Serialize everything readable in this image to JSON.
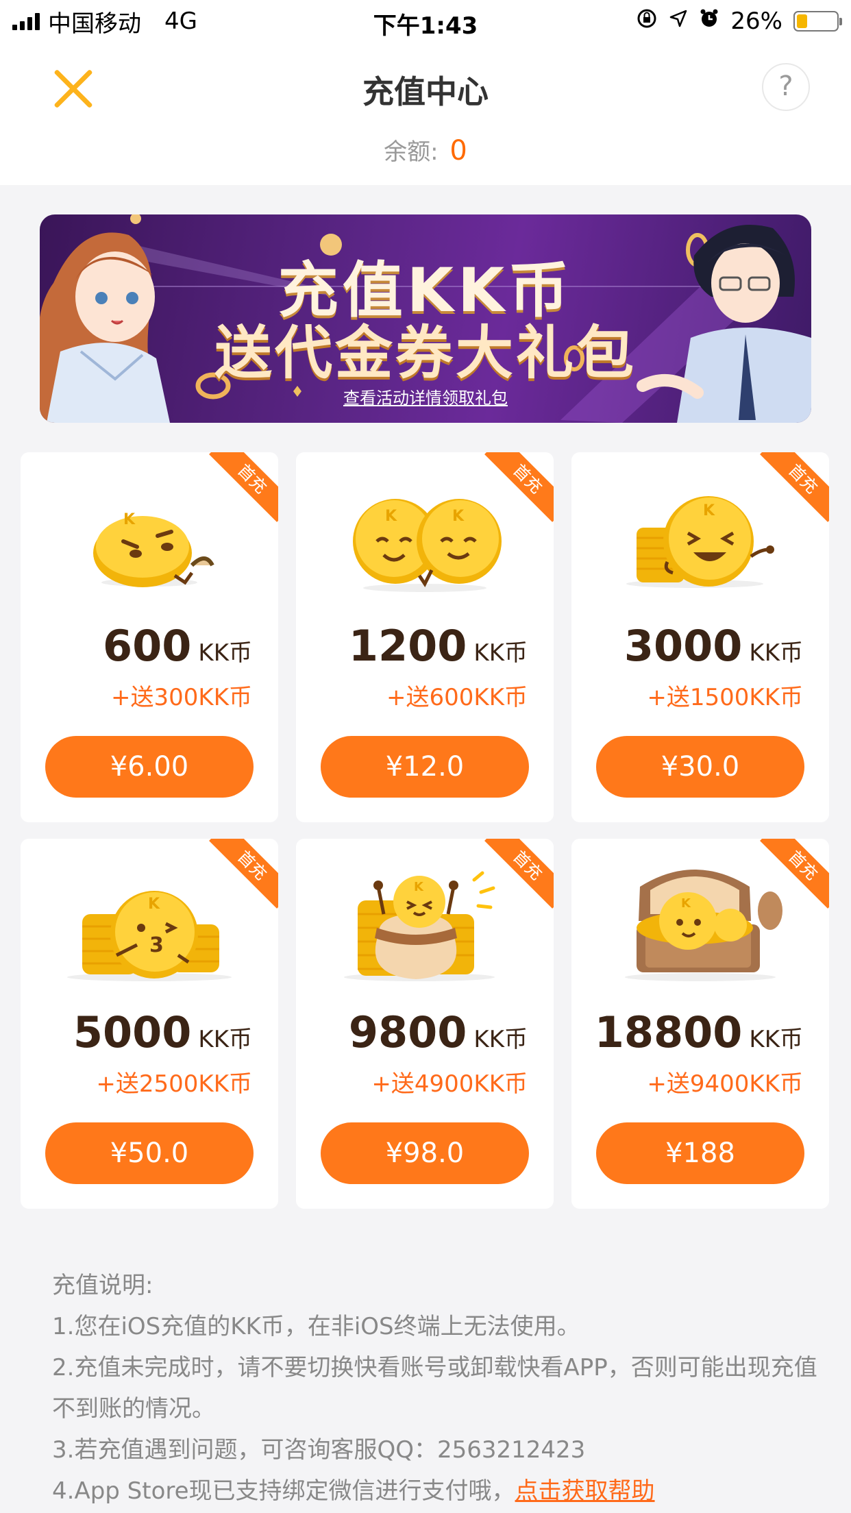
{
  "status_bar": {
    "carrier": "中国移动",
    "network": "4G",
    "time": "下午1:43",
    "battery_percent_text": "26%",
    "battery_level": 0.26
  },
  "header": {
    "title": "充值中心",
    "help_label": "?",
    "balance_label": "余额:",
    "balance_value": "0"
  },
  "banner": {
    "title": "充值KK币",
    "subtitle": "送代金券大礼包",
    "link_text": "查看活动详情领取礼包"
  },
  "packages": [
    {
      "amount": "600",
      "unit": "KK币",
      "bonus": "+送300KK币",
      "price": "¥6.00",
      "badge": "首充",
      "icon": "single-coin-icon"
    },
    {
      "amount": "1200",
      "unit": "KK币",
      "bonus": "+送600KK币",
      "price": "¥12.0",
      "badge": "首充",
      "icon": "double-coin-icon"
    },
    {
      "amount": "3000",
      "unit": "KK币",
      "bonus": "+送1500KK币",
      "price": "¥30.0",
      "badge": "首充",
      "icon": "coin-stack-icon"
    },
    {
      "amount": "5000",
      "unit": "KK币",
      "bonus": "+送2500KK币",
      "price": "¥50.0",
      "badge": "首充",
      "icon": "coin-piles-icon"
    },
    {
      "amount": "9800",
      "unit": "KK币",
      "bonus": "+送4900KK币",
      "price": "¥98.0",
      "badge": "首充",
      "icon": "coin-bag-icon"
    },
    {
      "amount": "18800",
      "unit": "KK币",
      "bonus": "+送9400KK币",
      "price": "¥188",
      "badge": "首充",
      "icon": "treasure-chest-icon"
    }
  ],
  "notes": {
    "heading": "充值说明:",
    "line1": "1.您在iOS充值的KK币，在非iOS终端上无法使用。",
    "line2": "2.充值未完成时，请不要切换快看账号或卸载快看APP，否则可能出现充值不到账的情况。",
    "line3": "3.若充值遇到问题，可咨询客服QQ：2563212423",
    "line4_prefix": "4.App Store现已支持绑定微信进行支付哦，",
    "line4_link": "点击获取帮助"
  },
  "colors": {
    "accent": "#ff781a",
    "close_icon": "#fdb31c",
    "amount_text": "#3b2415",
    "background": "#f4f4f6"
  }
}
